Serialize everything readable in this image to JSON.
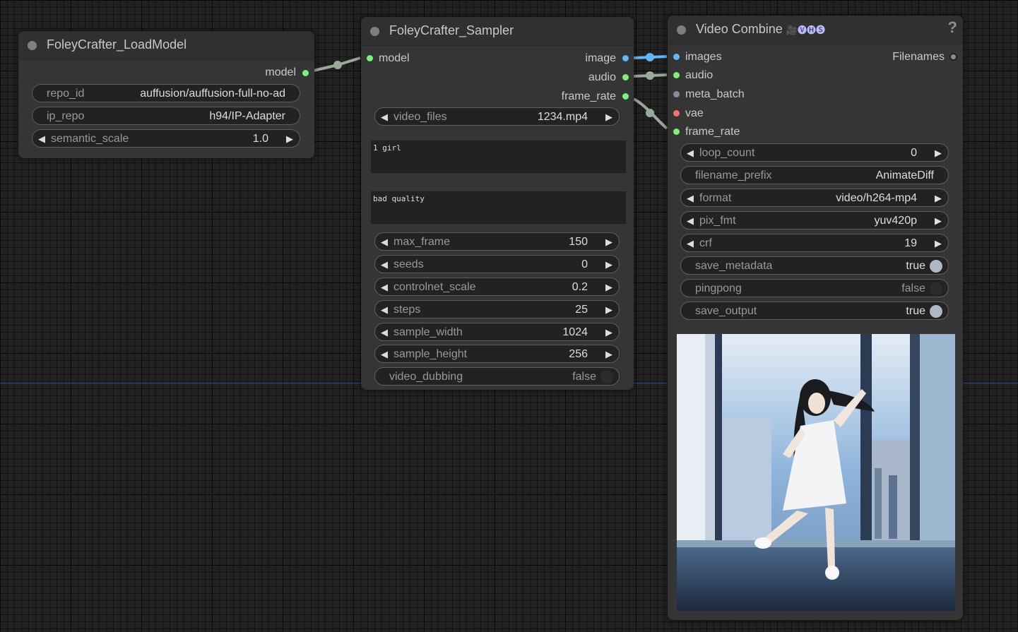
{
  "nodes": {
    "load_model": {
      "title": "FoleyCrafter_LoadModel",
      "outputs": [
        "model"
      ],
      "widgets": [
        {
          "name": "repo_id",
          "value": "auffusion/auffusion-full-no-ad"
        },
        {
          "name": "ip_repo",
          "value": "h94/IP-Adapter"
        },
        {
          "name": "semantic_scale",
          "value": "1.0"
        }
      ]
    },
    "sampler": {
      "title": "FoleyCrafter_Sampler",
      "inputs": [
        "model"
      ],
      "outputs": [
        "image",
        "audio",
        "frame_rate"
      ],
      "video_files": {
        "name": "video_files",
        "value": "1234.mp4"
      },
      "positive_prompt": "1 girl",
      "negative_prompt": "bad quality",
      "widgets": [
        {
          "name": "max_frame",
          "value": "150"
        },
        {
          "name": "seeds",
          "value": "0"
        },
        {
          "name": "controlnet_scale",
          "value": "0.2"
        },
        {
          "name": "steps",
          "value": "25"
        },
        {
          "name": "sample_width",
          "value": "1024"
        },
        {
          "name": "sample_height",
          "value": "256"
        }
      ],
      "video_dubbing": {
        "name": "video_dubbing",
        "value": "false"
      }
    },
    "video_combine": {
      "title": "Video Combine",
      "badge": "🎥🅥🅗🅢",
      "help": "?",
      "inputs": [
        "images",
        "audio",
        "meta_batch",
        "vae",
        "frame_rate"
      ],
      "outputs": [
        "Filenames"
      ],
      "loop_count": {
        "name": "loop_count",
        "value": "0"
      },
      "filename_prefix": {
        "name": "filename_prefix",
        "value": "AnimateDiff"
      },
      "format": {
        "name": "format",
        "value": "video/h264-mp4"
      },
      "pix_fmt": {
        "name": "pix_fmt",
        "value": "yuv420p"
      },
      "crf": {
        "name": "crf",
        "value": "19"
      },
      "save_metadata": {
        "name": "save_metadata",
        "value": "true"
      },
      "pingpong": {
        "name": "pingpong",
        "value": "false"
      },
      "save_output": {
        "name": "save_output",
        "value": "true"
      }
    }
  },
  "colors": {
    "canvas": "#222222",
    "node_body": "#353535",
    "model_slot": "#7ef07e",
    "image_slot": "#64b5f6",
    "vae_slot": "#ff6e6e",
    "meta_slot": "#8a8aa0",
    "link_image": "#64b5f6",
    "link_default": "#9aa99a"
  }
}
